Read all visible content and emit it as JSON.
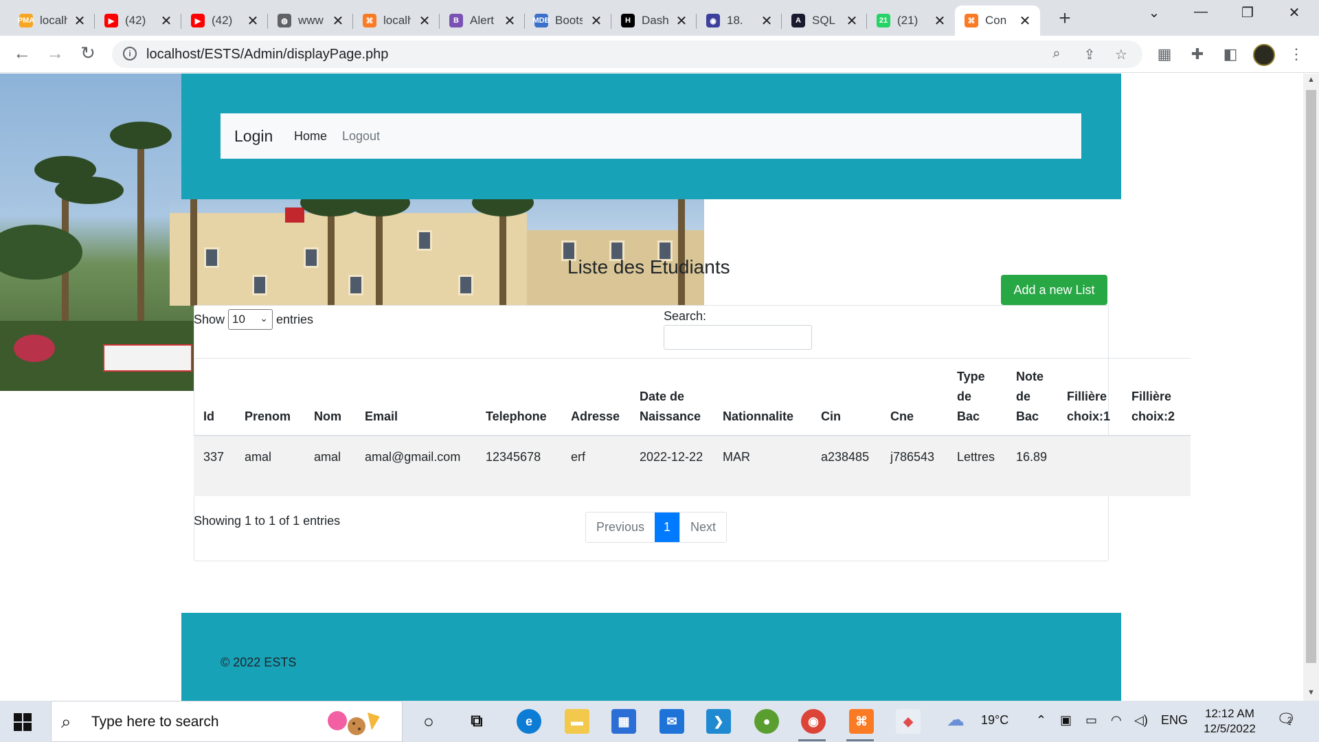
{
  "browser": {
    "tabs": [
      {
        "title": "localhost",
        "fav_text": "PMA",
        "fav_color": "#f6a623"
      },
      {
        "title": "(42)",
        "fav_text": "▶",
        "fav_color": "#ff0000"
      },
      {
        "title": "(42)",
        "fav_text": "▶",
        "fav_color": "#ff0000"
      },
      {
        "title": "www",
        "fav_text": "◍",
        "fav_color": "#5f6368"
      },
      {
        "title": "localhost",
        "fav_text": "⌘",
        "fav_color": "#fb7a24"
      },
      {
        "title": "Alert",
        "fav_text": "B",
        "fav_color": "#7952b3"
      },
      {
        "title": "Bootstrap",
        "fav_text": "MDB",
        "fav_color": "#3b71ca"
      },
      {
        "title": "Dashboard",
        "fav_text": "H",
        "fav_color": "#000000"
      },
      {
        "title": "18.",
        "fav_text": "◉",
        "fav_color": "#3c3f9b"
      },
      {
        "title": "SQL",
        "fav_text": "A",
        "fav_color": "#1a1a2e"
      },
      {
        "title": "(21)",
        "fav_text": "21",
        "fav_color": "#25d366"
      },
      {
        "title": "Con",
        "fav_text": "⌘",
        "fav_color": "#fb7a24"
      }
    ],
    "url": "localhost/ESTS/Admin/displayPage.php"
  },
  "page": {
    "brand": "Login",
    "nav": {
      "home": "Home",
      "logout": "Logout"
    },
    "title": "Liste des Etudiants",
    "add_button": "Add a new List",
    "show_label": "Show",
    "entries_label": "entries",
    "page_size": "10",
    "search_label": "Search:",
    "columns": [
      "Id",
      "Prenom",
      "Nom",
      "Email",
      "Telephone",
      "Adresse",
      "Date de Naissance",
      "Nationnalite",
      "Cin",
      "Cne",
      "Type de Bac",
      "Note de Bac",
      "Fillière choix:1",
      "Fillière choix:2"
    ],
    "rows": [
      [
        "337",
        "amal",
        "amal",
        "amal@gmail.com",
        "12345678",
        "erf",
        "2022-12-22",
        "MAR",
        "a238485",
        "j786543",
        "Lettres",
        "16.89",
        "",
        ""
      ]
    ],
    "info": "Showing 1 to 1 of 1 entries",
    "pagination": {
      "previous": "Previous",
      "current": "1",
      "next": "Next"
    },
    "footer": "© 2022 ESTS"
  },
  "taskbar": {
    "search_placeholder": "Type here to search",
    "weather": "19°C",
    "language": "ENG",
    "time": "12:12 AM",
    "date": "12/5/2022",
    "notifications": "2"
  }
}
